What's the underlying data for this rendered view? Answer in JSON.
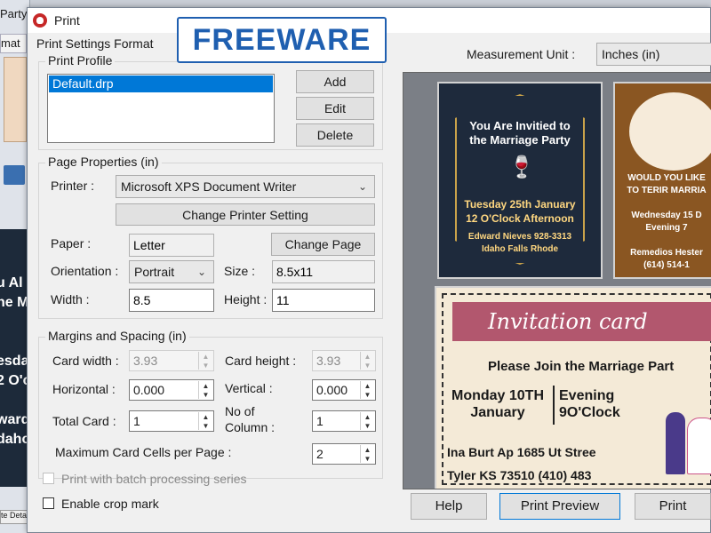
{
  "background_app": {
    "title_fragment": "Party",
    "tab_fragment": "mat",
    "card_text": [
      "u Al",
      "ne M",
      "",
      "",
      "esda",
      "2 O'c",
      "",
      "ward",
      "daho"
    ],
    "bottom_fragment": "te Deta"
  },
  "dialog": {
    "title": "Print",
    "watermark": "FREEWARE",
    "section_title": "Print Settings Format",
    "measurement_label": "Measurement Unit :",
    "measurement_value": "Inches (in)"
  },
  "print_profile": {
    "label": "Print Profile",
    "items": [
      "Default.drp"
    ],
    "add_label": "Add",
    "edit_label": "Edit",
    "delete_label": "Delete"
  },
  "page_properties": {
    "label": "Page Properties  (in)",
    "printer_label": "Printer :",
    "printer_value": "Microsoft XPS Document Writer",
    "change_printer_label": "Change Printer Setting",
    "paper_label": "Paper  :",
    "paper_value": "Letter",
    "change_page_label": "Change Page",
    "orientation_label": "Orientation :",
    "orientation_value": "Portrait",
    "size_label": "Size  :",
    "size_value": "8.5x11",
    "width_label": "Width  :",
    "width_value": "8.5",
    "height_label": "Height :",
    "height_value": "11"
  },
  "margins": {
    "label": "Margins and Spacing  (in)",
    "card_width_label": "Card width :",
    "card_width_value": "3.93",
    "card_height_label": "Card height :",
    "card_height_value": "3.93",
    "horizontal_label": "Horizontal  :",
    "horizontal_value": "0.000",
    "vertical_label": "Vertical  :",
    "vertical_value": "0.000",
    "total_card_label": "Total Card  :",
    "total_card_value": "1",
    "columns_label_1": "No of",
    "columns_label_2": "Column  :",
    "columns_value": "1",
    "max_cells_label": "Maximum Card Cells per Page  :",
    "max_cells_value": "2"
  },
  "options": {
    "batch_label": "Print with batch processing series",
    "batch_checked": false,
    "crop_label": "Enable crop mark",
    "crop_checked": false
  },
  "preview": {
    "card1": {
      "title": [
        "You Are Invitied to",
        "the Marriage  Party"
      ],
      "date": [
        "Tuesday 25th January",
        "12 O'Clock Afternoon"
      ],
      "contact": [
        "Edward Nieves 928-3313",
        "Idaho Falls Rhode"
      ]
    },
    "card2": {
      "lines": [
        "WOULD YOU LIKE",
        "TO TERIR MARRIA",
        "",
        "Wednesday 15 D",
        "Evening 7",
        "",
        "Remedios Hester",
        "(614) 514-1"
      ]
    },
    "card3": {
      "banner": "Invitation card",
      "heading": "Please Join the Marriage Part",
      "date": [
        "Monday 10TH",
        "January"
      ],
      "time": [
        "Evening",
        "9O'Clock"
      ],
      "address": [
        "Ina Burt Ap 1685 Ut Stree",
        "Tyler KS 73510 (410) 483"
      ]
    }
  },
  "buttons": {
    "help_label": "Help",
    "print_preview_label": "Print Preview",
    "print_label": "Print"
  },
  "colors": {
    "accent": "#0078d7",
    "watermark": "#1f5fb0",
    "dialog_bg": "#f0f0f0"
  }
}
